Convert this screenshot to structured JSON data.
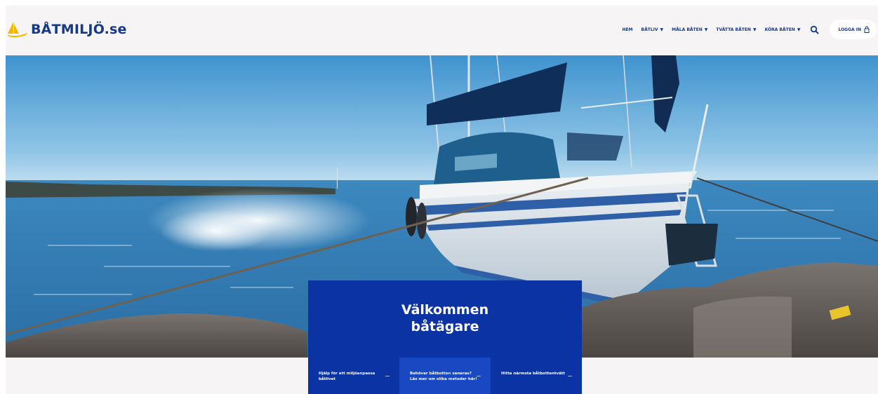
{
  "brand": {
    "name": "BÅTMILJÖ.se",
    "color": "#163a8a",
    "accent": "#f5b800"
  },
  "nav": {
    "items": [
      {
        "label": "HEM",
        "dropdown": false
      },
      {
        "label": "BÅTLIV",
        "dropdown": true
      },
      {
        "label": "MÅLA BÅTEN",
        "dropdown": true
      },
      {
        "label": "TVÄTTA BÅTEN",
        "dropdown": true
      },
      {
        "label": "KÖRA BÅTEN",
        "dropdown": true
      }
    ],
    "search_icon": "search-icon",
    "login_label": "LOGGA IN",
    "login_icon": "lock-icon"
  },
  "hero": {
    "image": "sailboat moored at rocky shore",
    "title": "Välkommen\nbåtägare",
    "panel_color": "#0b33a4",
    "cards": [
      {
        "label": "Hjälp för att miljöanpassa båtlivet"
      },
      {
        "label": "Behöver båtbotten saneras? Läs mer om olika metoder här!"
      },
      {
        "label": "Hitta närmsta båtbottentvätt"
      }
    ]
  }
}
